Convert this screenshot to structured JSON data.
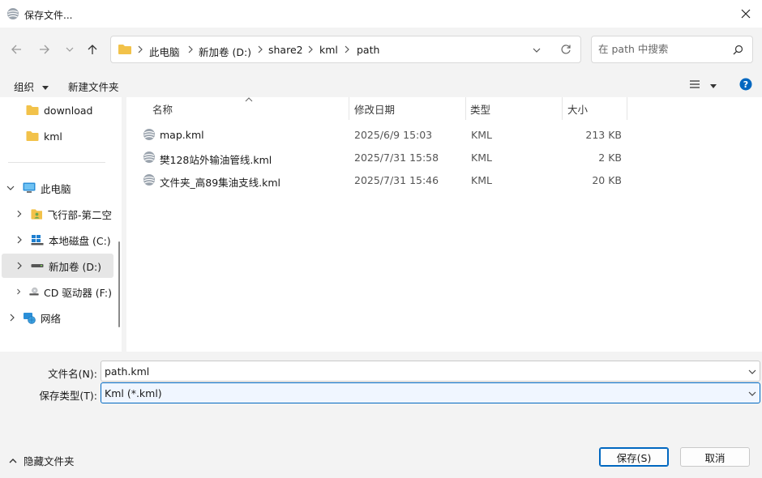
{
  "window": {
    "title": "保存文件..."
  },
  "address": {
    "crumbs": [
      "此电脑",
      "新加卷 (D:)",
      "share2",
      "kml",
      "path"
    ]
  },
  "search": {
    "placeholder": "在 path 中搜索"
  },
  "toolbar": {
    "organize": "组织",
    "new_folder": "新建文件夹"
  },
  "nav": {
    "items": [
      {
        "label": "download",
        "icon": "folder-icon"
      },
      {
        "label": "kml",
        "icon": "folder-icon"
      },
      {
        "label": "此电脑",
        "icon": "computer-icon"
      },
      {
        "label": "飞行部-第二空",
        "icon": "folder-user-icon"
      },
      {
        "label": "本地磁盘 (C:)",
        "icon": "windows-drive-icon"
      },
      {
        "label": "新加卷 (D:)",
        "icon": "drive-icon"
      },
      {
        "label": "CD 驱动器 (F:)",
        "icon": "cd-drive-icon"
      },
      {
        "label": "网络",
        "icon": "network-icon"
      }
    ]
  },
  "columns": {
    "name": "名称",
    "modified": "修改日期",
    "type": "类型",
    "size": "大小"
  },
  "files": [
    {
      "name": "map.kml",
      "modified": "2025/6/9 15:03",
      "type": "KML",
      "size": "213 KB"
    },
    {
      "name": "樊128站外输油管线.kml",
      "modified": "2025/7/31 15:58",
      "type": "KML",
      "size": "2 KB"
    },
    {
      "name": "文件夹_高89集油支线.kml",
      "modified": "2025/7/31 15:46",
      "type": "KML",
      "size": "20 KB"
    }
  ],
  "form": {
    "filename_label": "文件名(N):",
    "filename_value": "path.kml",
    "filetype_label": "保存类型(T):",
    "filetype_value": "Kml (*.kml)"
  },
  "footer": {
    "hide_folders": "隐藏文件夹",
    "save": "保存(S)",
    "cancel": "取消"
  },
  "colors": {
    "accent": "#0067c0",
    "folder": "#f2c24a",
    "selection": "#e6e6e6"
  }
}
